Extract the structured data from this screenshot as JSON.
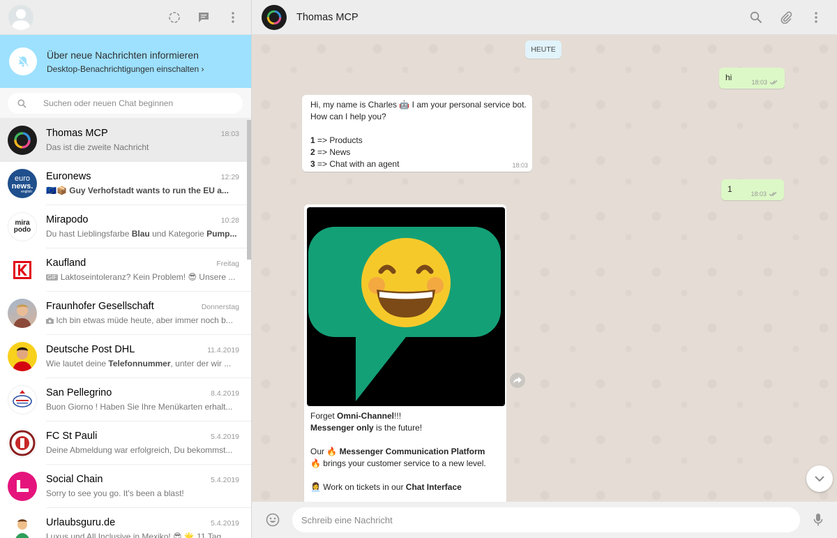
{
  "sidebar": {
    "notification": {
      "title": "Über neue Nachrichten informieren",
      "subtitle": "Desktop-Benachrichtigungen einschalten ›"
    },
    "search": {
      "placeholder": "Suchen oder neuen Chat beginnen"
    },
    "chats": [
      {
        "name": "Thomas MCP",
        "time": "18:03",
        "preview": "Das ist die zweite Nachricht"
      },
      {
        "name": "Euronews",
        "time": "12:29",
        "preview_prefix": "🇪🇺📦",
        "preview_bold": "Guy Verhofstadt wants to run the EU a..."
      },
      {
        "name": "Mirapodo",
        "time": "10:28",
        "preview_p1": "Du hast Lieblingsfarbe ",
        "preview_b1": "Blau",
        "preview_p2": " und Kategorie ",
        "preview_b2": "Pump..."
      },
      {
        "name": "Kaufland",
        "time": "Freitag",
        "gif": "GIF",
        "preview": "Laktoseintoleranz? Kein Problem! 😎 Unsere ..."
      },
      {
        "name": "Fraunhofer Gesellschaft",
        "time": "Donnerstag",
        "preview": "Ich bin etwas müde heute, aber immer noch b..."
      },
      {
        "name": "Deutsche Post DHL",
        "time": "11.4.2019",
        "preview_p1": "Wie lautet deine ",
        "preview_b1": "Telefonnummer",
        "preview_p2": ", unter der wir ..."
      },
      {
        "name": "San Pellegrino",
        "time": "8.4.2019",
        "preview": "Buon Giorno ! Haben Sie Ihre Menükarten erhalt..."
      },
      {
        "name": "FC St Pauli",
        "time": "5.4.2019",
        "preview": "Deine Abmeldung war erfolgreich, Du bekommst..."
      },
      {
        "name": "Social Chain",
        "time": "5.4.2019",
        "preview": "Sorry to see you go. It's been a blast!"
      },
      {
        "name": "Urlaubsguru.de",
        "time": "5.4.2019",
        "preview": "Luxus und All Inclusive in Mexiko! 😎 🌟 11 Tag..."
      }
    ],
    "avatar_texts": {
      "euronews_1": "euro",
      "euronews_2": "news.",
      "euronews_3": "english",
      "mirapodo_1": "mira",
      "mirapodo_2": "podo",
      "stpauli": "FC ST. PAULI 1910"
    }
  },
  "conversation": {
    "title": "Thomas MCP",
    "day_badge": "HEUTE",
    "messages": {
      "m1": {
        "text": "hi",
        "time": "18:03"
      },
      "m2": {
        "l1a": "Hi, my name is Charles ",
        "l1b": "🤖",
        "l1c": " I am your personal service bot.",
        "l2": "How can I help you?",
        "o1n": "1",
        "o1t": " => Products",
        "o2n": "2",
        "o2t": " => News",
        "o3n": "3",
        "o3t": " => Chat with an agent",
        "time": "18:03"
      },
      "m3": {
        "text": "1",
        "time": "18:03"
      },
      "m4": {
        "c1a": "Forget ",
        "c1b": "Omni-Channel",
        "c1c": "!!!",
        "c2a": "Messenger only",
        "c2b": " is the future!",
        "c3a": "Our ",
        "c3e": "🔥",
        "c3b": " Messenger Communication Platform",
        "c4e": "🔥",
        "c4a": " brings your customer service to a new level.",
        "c5e": "👩‍💼",
        "c5a": " Work on tickets in our ",
        "c5b": "Chat Interface"
      }
    },
    "compose_placeholder": "Schreib eine Nachricht"
  },
  "colors": {
    "header_bg": "#ededed",
    "notify_bg": "#9de1fe",
    "outgoing_bubble": "#dcf8c6",
    "incoming_bubble": "#ffffff",
    "image_green": "#14a077",
    "chat_bg": "#e5ddd5"
  }
}
